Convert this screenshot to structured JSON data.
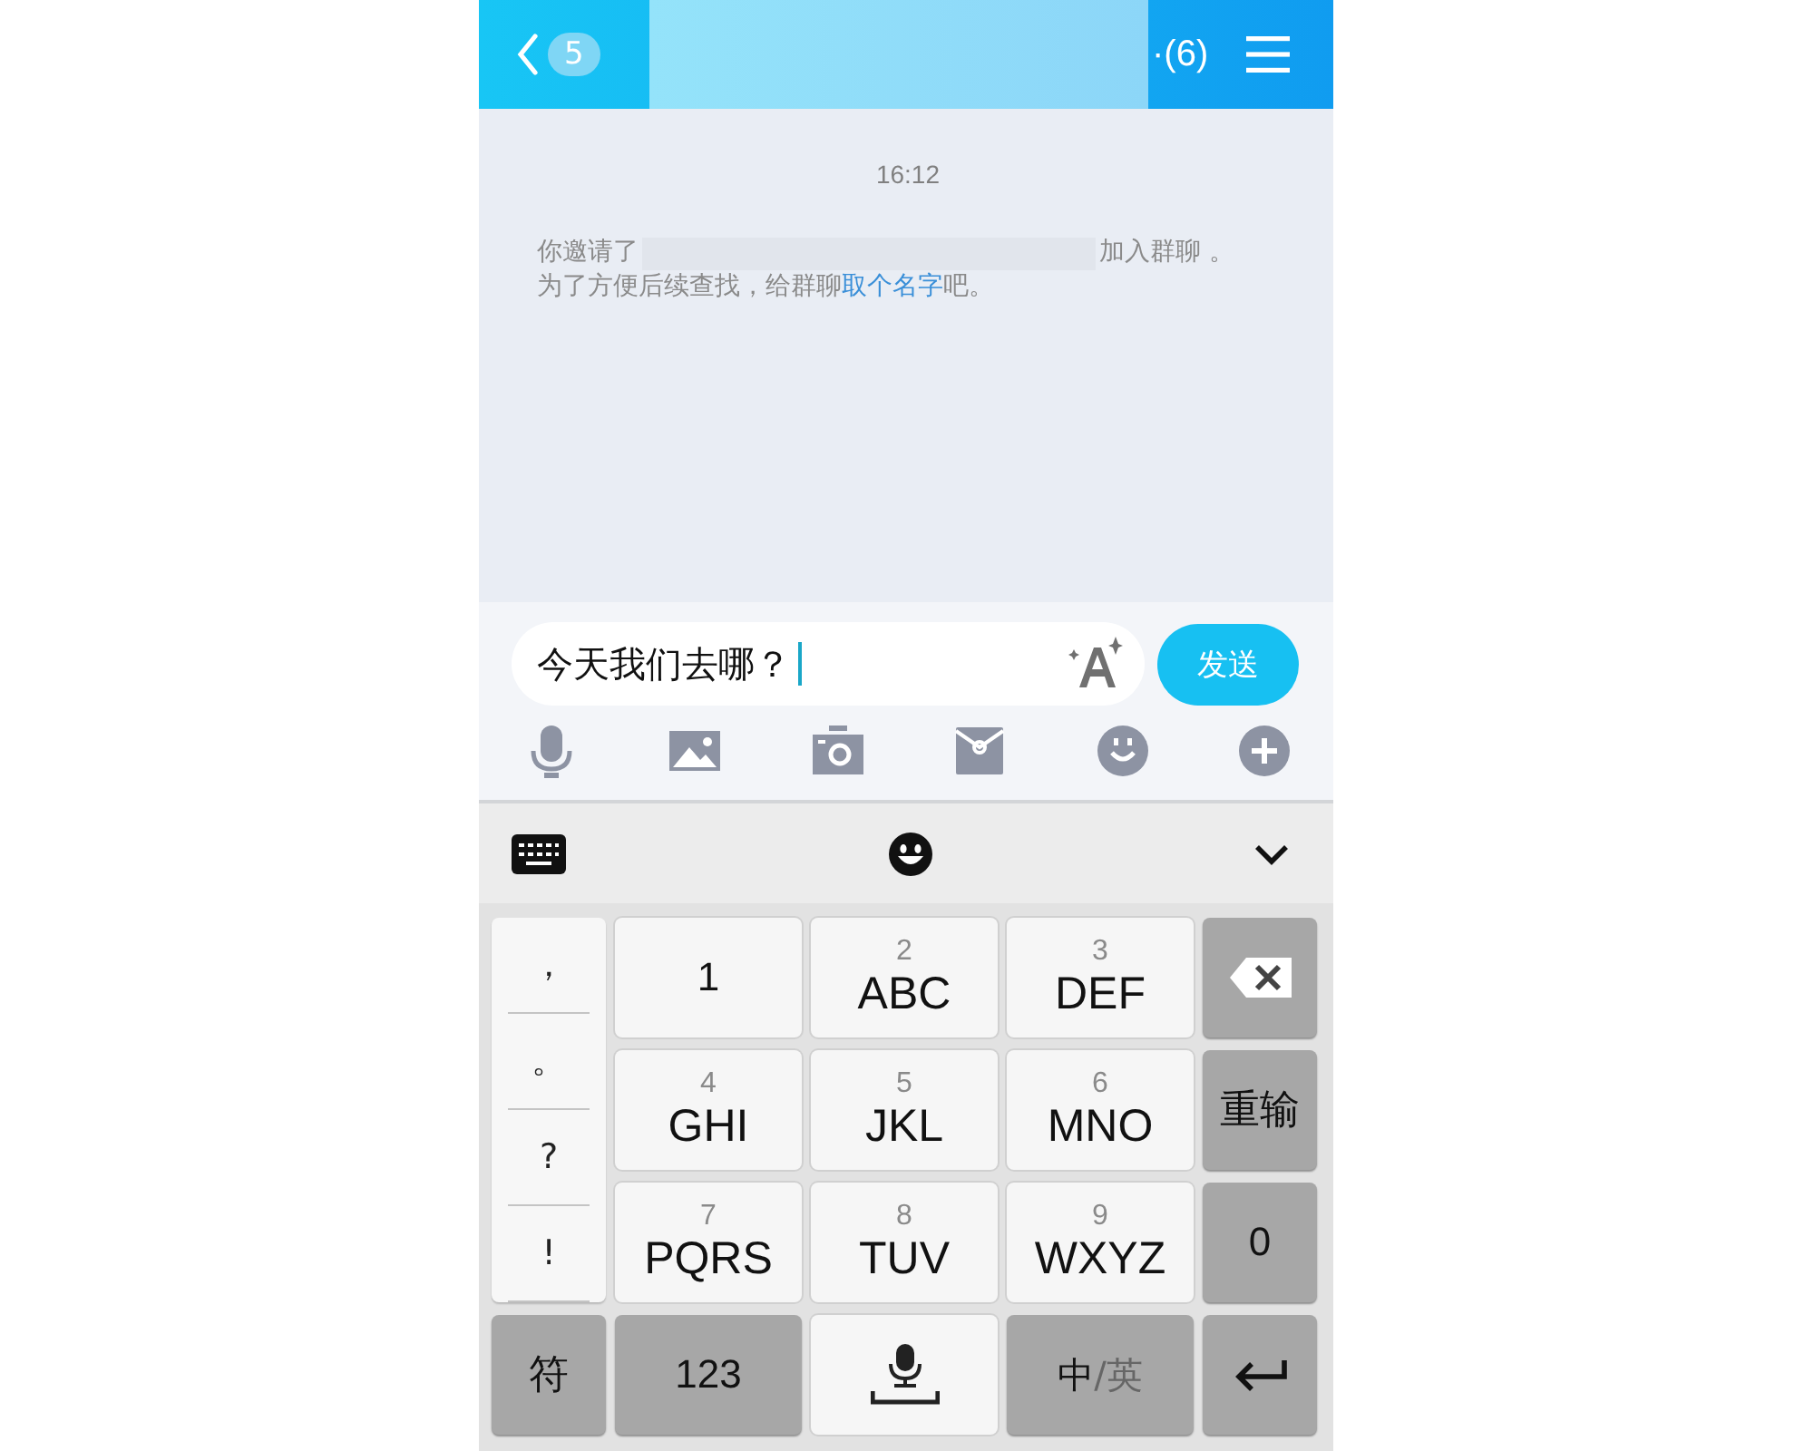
{
  "header": {
    "unread_count": "5",
    "title": "·(6)"
  },
  "chat": {
    "timestamp": "16:12",
    "notice": {
      "before": "你邀请了",
      "after": "加入群聊 。",
      "hint": "为了方便后续查找，给群聊",
      "link": "取个名字",
      "hint_end": "吧。"
    }
  },
  "composer": {
    "value": "今天我们去哪？",
    "send": "发送"
  },
  "keyboard": {
    "punctuation": [
      "，",
      "。",
      "?",
      "!"
    ],
    "keys": [
      {
        "kind": "single",
        "label": "1"
      },
      {
        "kind": "t9",
        "digit": "2",
        "letters": "ABC"
      },
      {
        "kind": "t9",
        "digit": "3",
        "letters": "DEF"
      },
      {
        "kind": "delete"
      },
      {
        "kind": "t9",
        "digit": "4",
        "letters": "GHI"
      },
      {
        "kind": "t9",
        "digit": "5",
        "letters": "JKL"
      },
      {
        "kind": "t9",
        "digit": "6",
        "letters": "MNO"
      },
      {
        "kind": "function",
        "label": "重输"
      },
      {
        "kind": "t9",
        "digit": "7",
        "letters": "PQRS"
      },
      {
        "kind": "t9",
        "digit": "8",
        "letters": "TUV"
      },
      {
        "kind": "t9",
        "digit": "9",
        "letters": "WXYZ"
      },
      {
        "kind": "function",
        "label": "0"
      },
      {
        "kind": "function",
        "label": "符"
      },
      {
        "kind": "function",
        "label": "123"
      },
      {
        "kind": "space"
      },
      {
        "kind": "lang",
        "label": "中",
        "alt": "/英"
      },
      {
        "kind": "enter"
      }
    ]
  }
}
